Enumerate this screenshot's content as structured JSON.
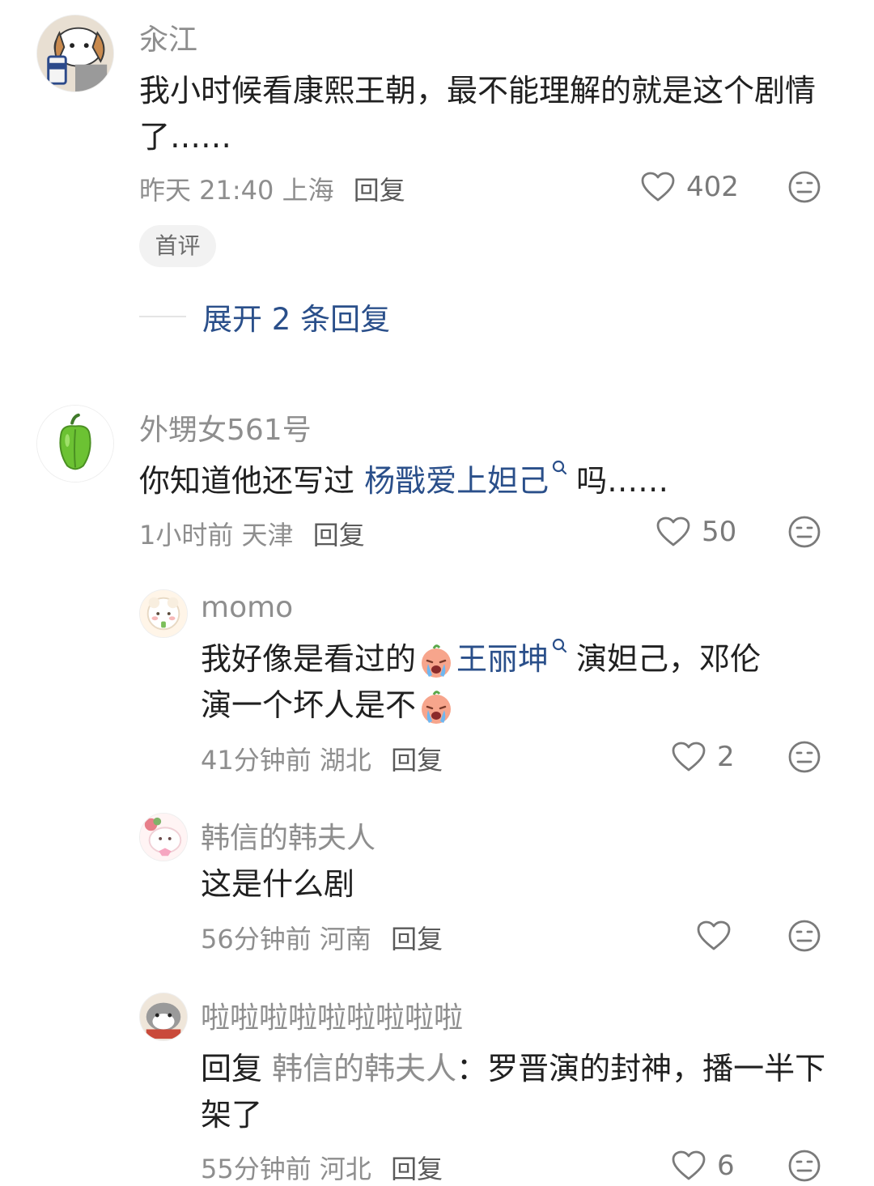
{
  "comments": [
    {
      "username": "汆江",
      "text": "我小时候看康熙王朝，最不能理解的就是这个剧情了……",
      "time": "昨天 21:40",
      "location": "上海",
      "reply_label": "回复",
      "likes": "402",
      "badge": "首评",
      "expand_label": "展开 2 条回复"
    },
    {
      "username": "外甥女561号",
      "text_before": "你知道他还写过",
      "link_text": "杨戬爱上妲己",
      "text_after": "吗……",
      "time": "1小时前",
      "location": "天津",
      "reply_label": "回复",
      "likes": "50"
    }
  ],
  "replies": [
    {
      "username": "momo",
      "text_part1": "我好像是看过的",
      "link_text": "王丽坤",
      "text_part2": "演妲己，邓伦",
      "text_part3": "演一个坏人是不",
      "time": "41分钟前",
      "location": "湖北",
      "reply_label": "回复",
      "likes": "2"
    },
    {
      "username": "韩信的韩夫人",
      "text": "这是什么剧",
      "time": "56分钟前",
      "location": "河南",
      "reply_label": "回复",
      "likes": ""
    },
    {
      "username": "啦啦啦啦啦啦啦啦啦",
      "reply_prefix": "回复",
      "reply_to": "韩信的韩夫人",
      "colon": "：",
      "text": "罗晋演的封神，播一半下架了",
      "time": "55分钟前",
      "location": "河北",
      "reply_label": "回复",
      "likes": "6"
    }
  ],
  "icons": {
    "like": "heart-outline-icon",
    "dislike": "neutral-face-icon",
    "search": "search-icon",
    "emoji": "crying-face-emoji"
  },
  "colors": {
    "link": "#2a4f8a",
    "meta": "#8e8e8e",
    "badge_bg": "#f2f2f2"
  }
}
